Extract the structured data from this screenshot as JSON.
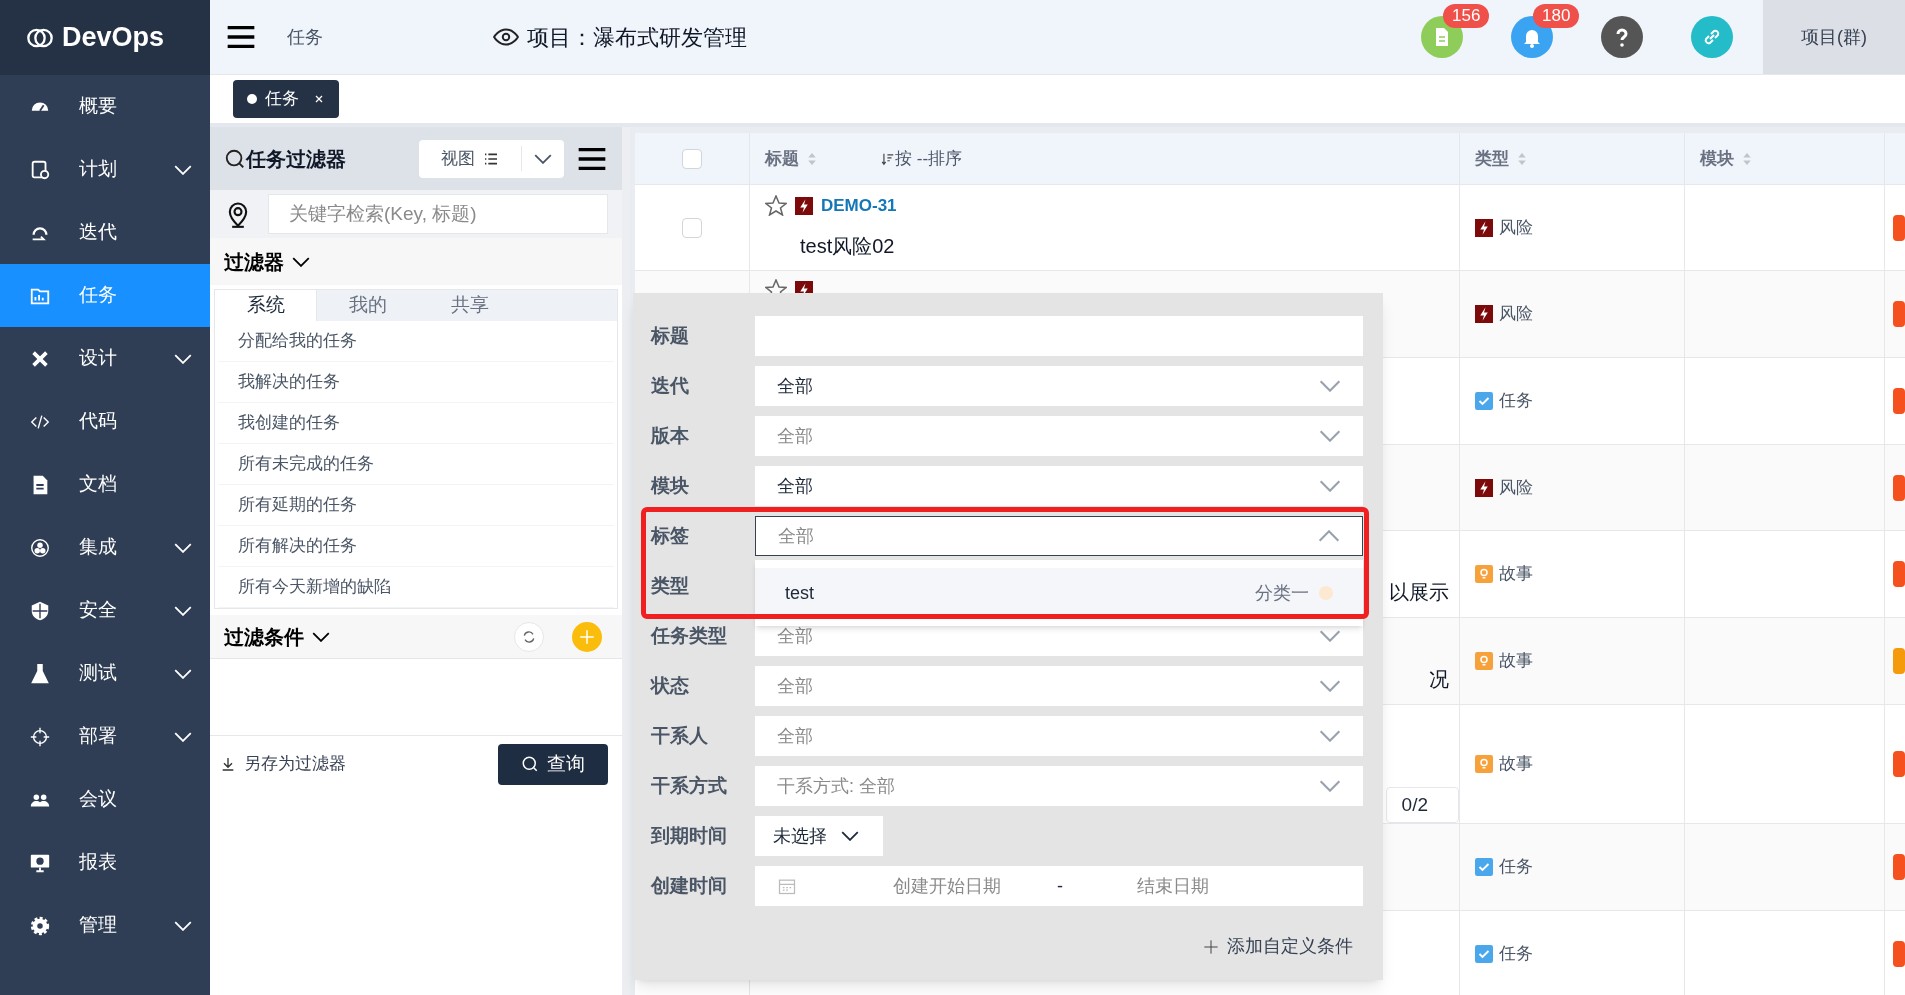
{
  "sidebar": {
    "logo": "DevOps",
    "items": [
      {
        "label": "概要",
        "expandable": false,
        "selected": false
      },
      {
        "label": "计划",
        "expandable": true,
        "selected": false
      },
      {
        "label": "迭代",
        "expandable": false,
        "selected": false
      },
      {
        "label": "任务",
        "expandable": false,
        "selected": true
      },
      {
        "label": "设计",
        "expandable": true,
        "selected": false
      },
      {
        "label": "代码",
        "expandable": false,
        "selected": false
      },
      {
        "label": "文档",
        "expandable": false,
        "selected": false
      },
      {
        "label": "集成",
        "expandable": true,
        "selected": false
      },
      {
        "label": "安全",
        "expandable": true,
        "selected": false
      },
      {
        "label": "测试",
        "expandable": true,
        "selected": false
      },
      {
        "label": "部署",
        "expandable": true,
        "selected": false
      },
      {
        "label": "会议",
        "expandable": false,
        "selected": false
      },
      {
        "label": "报表",
        "expandable": false,
        "selected": false
      },
      {
        "label": "管理",
        "expandable": true,
        "selected": false
      }
    ]
  },
  "topbar": {
    "breadcrumb": "任务",
    "project": "项目：瀑布式研发管理",
    "badges": [
      "156",
      "180"
    ],
    "project_group": "项目(群)"
  },
  "open_tabs": [
    {
      "label": "任务",
      "selected": true
    }
  ],
  "filter_panel": {
    "title": "任务过滤器",
    "view_button": "视图",
    "search": {
      "placeholder": "关键字检索(Key, 标题)"
    },
    "filters_heading": "过滤器",
    "tabs": [
      {
        "label": "系统",
        "selected": true
      },
      {
        "label": "我的",
        "selected": false
      },
      {
        "label": "共享",
        "selected": false
      }
    ],
    "saved_filters": [
      "分配给我的任务",
      "我解决的任务",
      "我创建的任务",
      "所有未完成的任务",
      "所有延期的任务",
      "所有解决的任务",
      "所有今天新增的缺陷"
    ],
    "conditions_heading": "过滤条件",
    "save_link": "另存为过滤器",
    "query_button": "查询"
  },
  "table": {
    "columns": [
      "标题",
      "类型",
      "模块"
    ],
    "select_all_checked": false,
    "sort_button": "按 --排序",
    "rows": [
      {
        "kind": "risk",
        "checked": false,
        "key": "DEMO-31",
        "title": "test风险02",
        "type": "风险",
        "color": "#f4511e"
      },
      {
        "kind": "risk",
        "type": "风险",
        "color": "#f4511e"
      },
      {
        "kind": "task",
        "type": "任务",
        "color": "#f4511e"
      },
      {
        "kind": "risk",
        "type": "风险",
        "color": "#f4511e"
      },
      {
        "kind": "story",
        "fragment": "以展示",
        "type": "故事",
        "color": "#f4511e"
      },
      {
        "kind": "story",
        "fragment": "况",
        "type": "故事",
        "color": "#f59a0b"
      },
      {
        "kind": "story",
        "subtasks": "0/2",
        "type": "故事",
        "color": "#f4511e"
      },
      {
        "kind": "task",
        "type": "任务",
        "color": "#f4511e"
      },
      {
        "kind": "task",
        "type": "任务",
        "color": "#f4511e"
      }
    ]
  },
  "filter_popup": {
    "fields": [
      {
        "label": "标题",
        "kind": "text"
      },
      {
        "label": "迭代",
        "kind": "select",
        "value": "全部"
      },
      {
        "label": "版本",
        "kind": "select",
        "placeholder": "全部"
      },
      {
        "label": "模块",
        "kind": "select",
        "value": "全部"
      },
      {
        "label": "标签",
        "kind": "select",
        "placeholder": "全部",
        "expanded": true,
        "highlighted": true,
        "options": [
          {
            "label": "test",
            "category": "分类一",
            "color": "#fde8d2"
          }
        ]
      },
      {
        "label": "类型",
        "kind": "hidden"
      },
      {
        "label": "任务类型",
        "kind": "select",
        "placeholder": "全部"
      },
      {
        "label": "状态",
        "kind": "select",
        "placeholder": "全部"
      },
      {
        "label": "干系人",
        "kind": "select",
        "placeholder": "全部"
      },
      {
        "label": "干系方式",
        "kind": "select",
        "placeholder": "干系方式: 全部"
      },
      {
        "label": "到期时间",
        "kind": "menu",
        "value": "未选择"
      },
      {
        "label": "创建时间",
        "kind": "date_range",
        "start_placeholder": "创建开始日期",
        "separator": "-",
        "end_placeholder": "结束日期"
      }
    ],
    "add_condition": "添加自定义条件"
  }
}
